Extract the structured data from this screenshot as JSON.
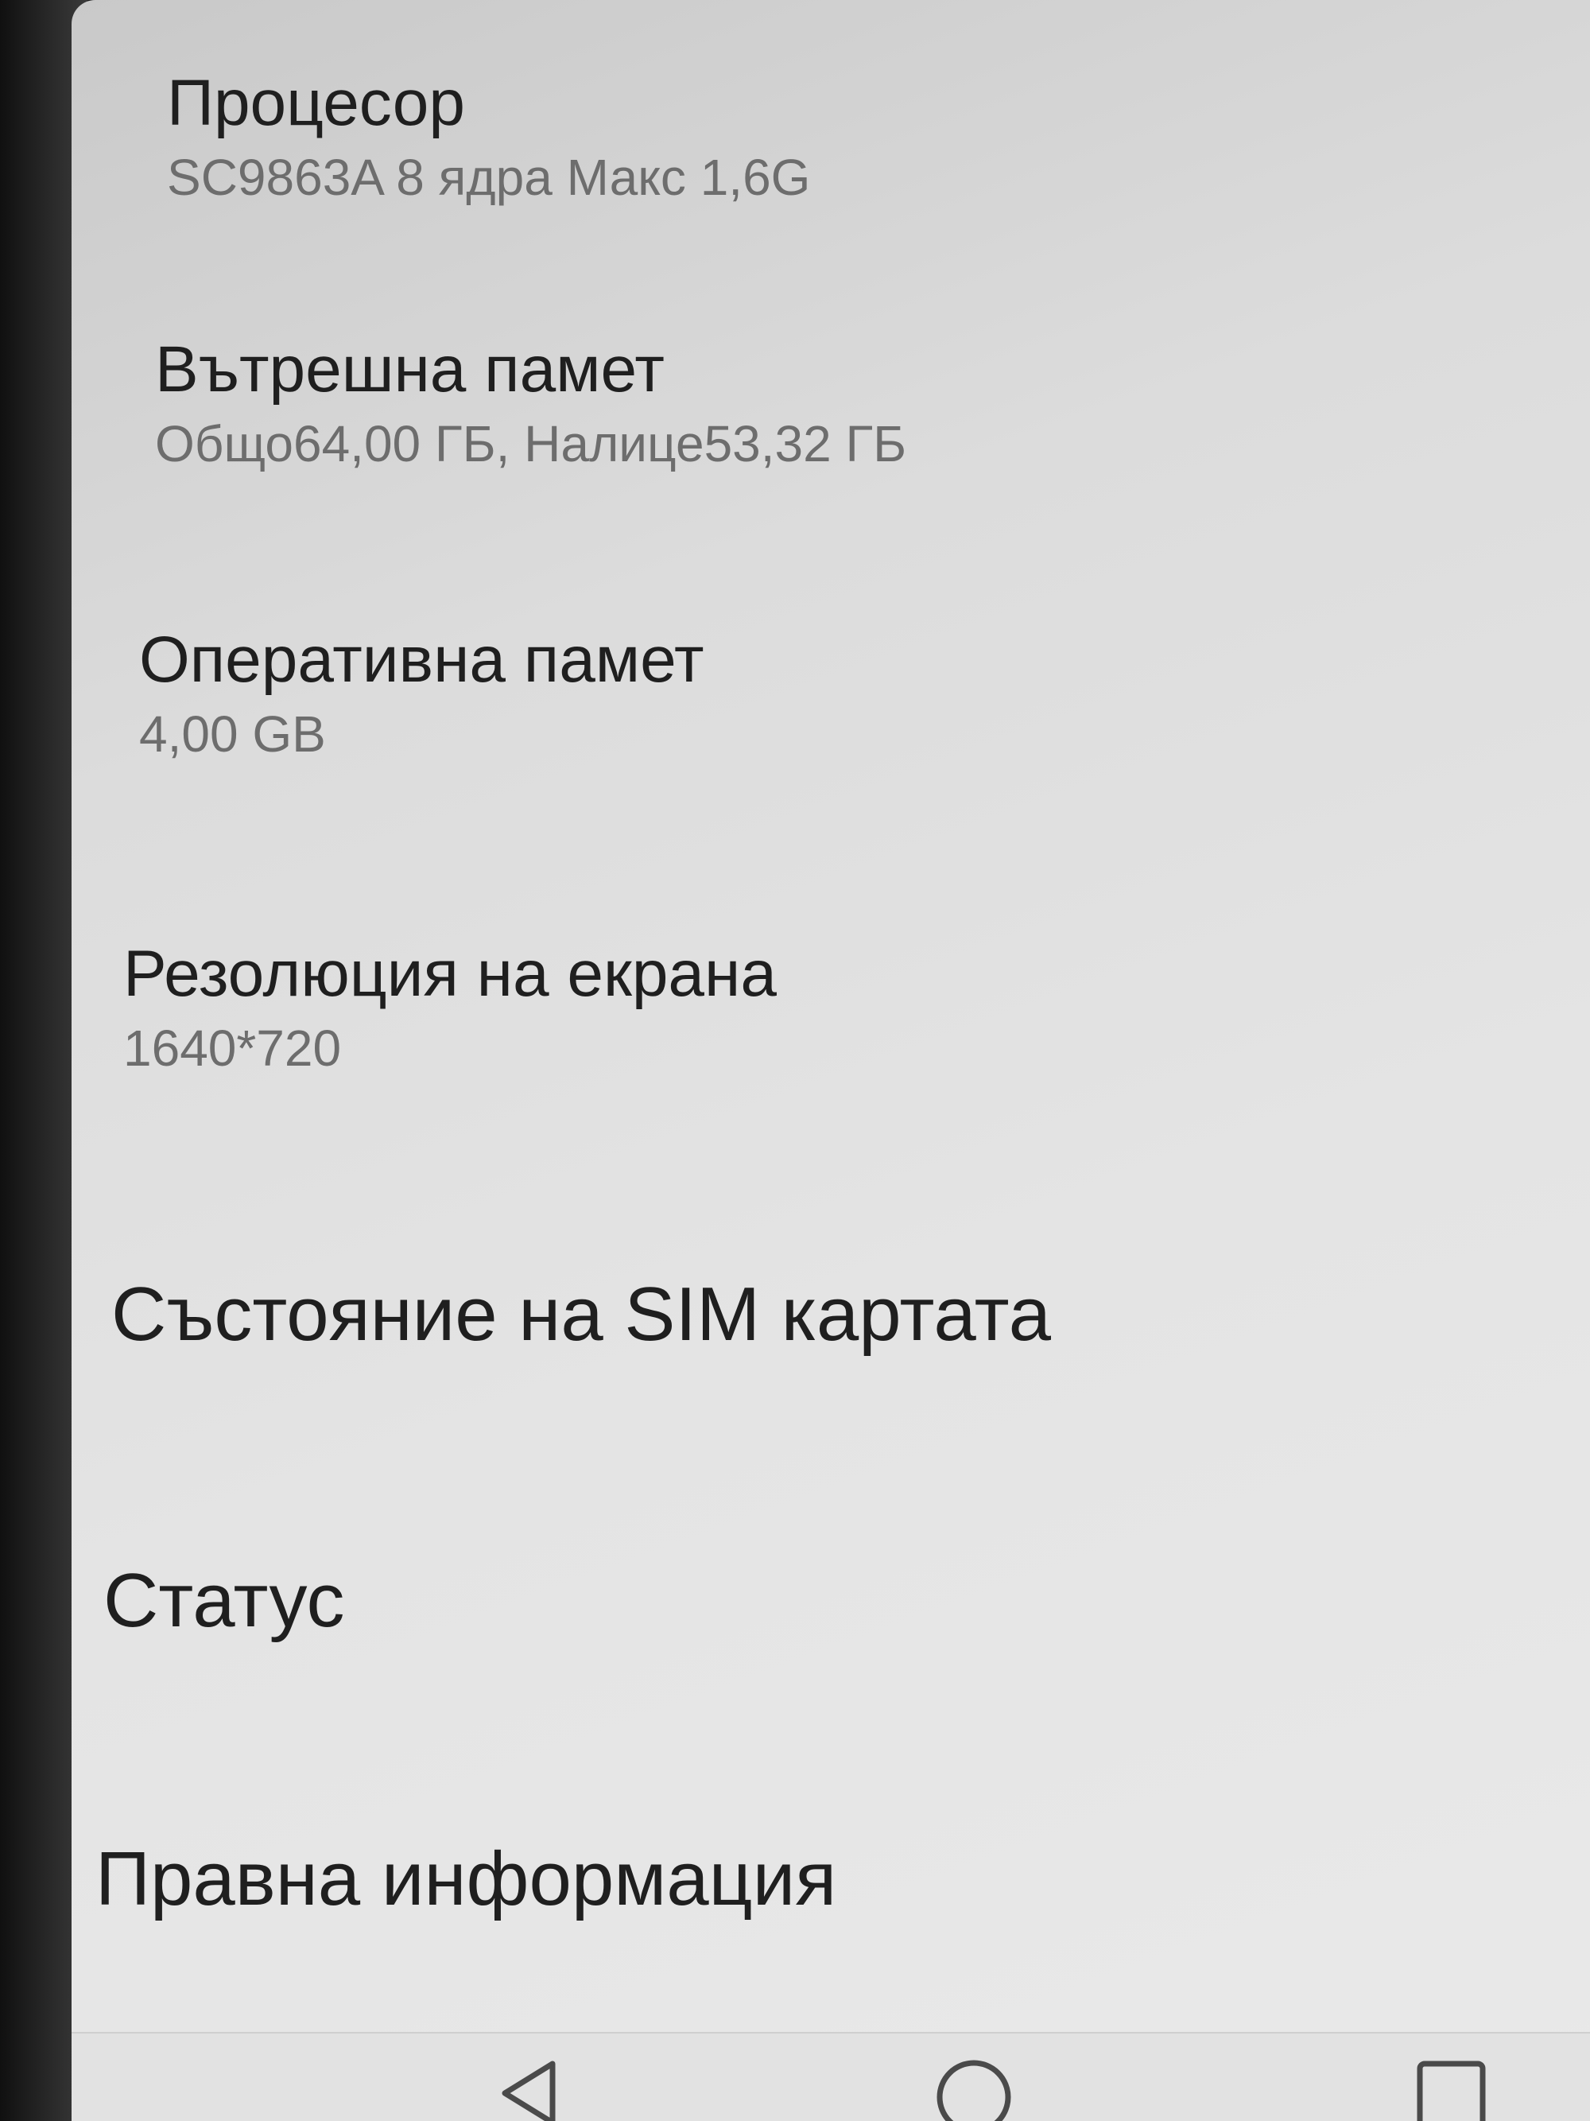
{
  "settings_list": {
    "items": [
      {
        "title": "Процесор",
        "summary": "SC9863A  8  ядра Макс 1,6G"
      },
      {
        "title": "Вътрешна памет",
        "summary": "Общо64,00 ГБ, Налице53,32 ГБ"
      },
      {
        "title": "Оперативна памет",
        "summary": "4,00 GB"
      },
      {
        "title": "Резолюция на екрана",
        "summary": "1640*720"
      },
      {
        "title": "Състояние на SIM картата"
      },
      {
        "title": "Статус"
      },
      {
        "title": "Правна информация"
      }
    ]
  },
  "navigation_bar": {
    "buttons": [
      {
        "icon": "back-triangle-icon"
      },
      {
        "icon": "home-circle-icon"
      },
      {
        "icon": "recents-square-icon"
      }
    ]
  },
  "colors": {
    "title_text": "#1f1f1f",
    "summary_text": "#6d6d6d",
    "background": "#e4e4e4"
  }
}
